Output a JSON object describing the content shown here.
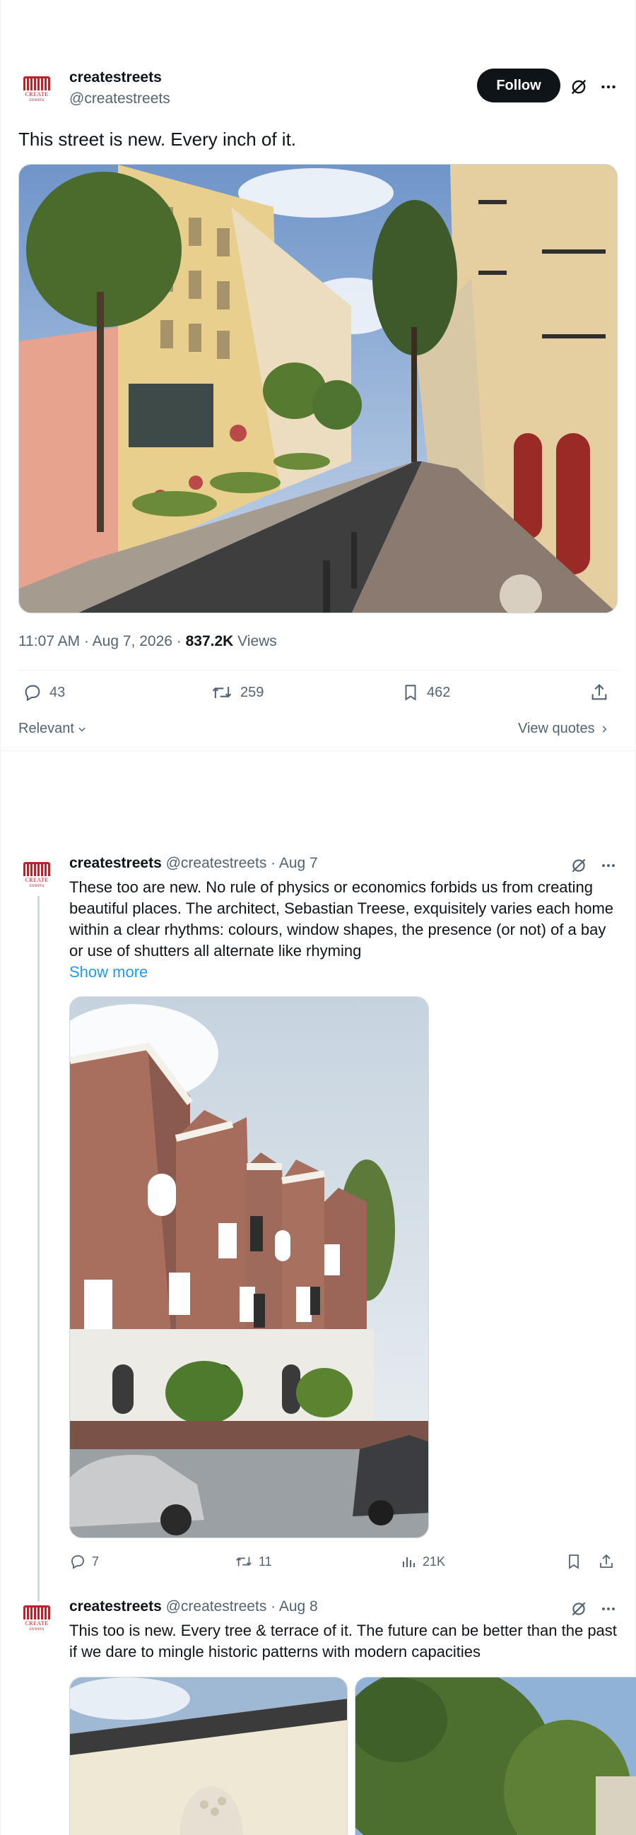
{
  "tweet": {
    "display_name": "createstreets",
    "handle": "@createstreets",
    "follow_label": "Follow",
    "text": "This street is new. Every inch of it.",
    "time": "11:07 AM · Aug 7, 2026 · ",
    "views_count": "837.2K",
    "views_label": " Views",
    "replies": "43",
    "retweets": "259",
    "bookmarks": "462",
    "sort_label": "Relevant",
    "quotes_label": "View quotes",
    "avatar_text_1": "CREATE",
    "avatar_text_2": "streets"
  },
  "replies": [
    {
      "display_name": "createstreets",
      "handle_date": "@createstreets · Aug 7",
      "text": "These too are new. No rule of physics or economics forbids us from creating beautiful places. The architect, Sebastian Treese, exquisitely varies each home within a clear rhythms: colours, window shapes, the presence (or not) of a bay or use of shutters all alternate like rhyming",
      "show_more": "Show more",
      "replies": "7",
      "retweets": "11",
      "views": "21K"
    },
    {
      "display_name": "createstreets",
      "handle_date": "@createstreets · Aug 8",
      "text": "This too is new. Every tree & terrace of it. The future can be better than the past if we dare to mingle historic patterns with modern capacities"
    }
  ],
  "icons": {
    "grok": "grok-icon",
    "more": "more-icon",
    "reply": "reply-icon",
    "retweet": "retweet-icon",
    "bookmark": "bookmark-icon",
    "share": "share-icon",
    "views": "views-icon"
  },
  "colors": {
    "text": "#0f1419",
    "secondary": "#536471",
    "link": "#1d9bf0",
    "brand": "#c0202a"
  }
}
